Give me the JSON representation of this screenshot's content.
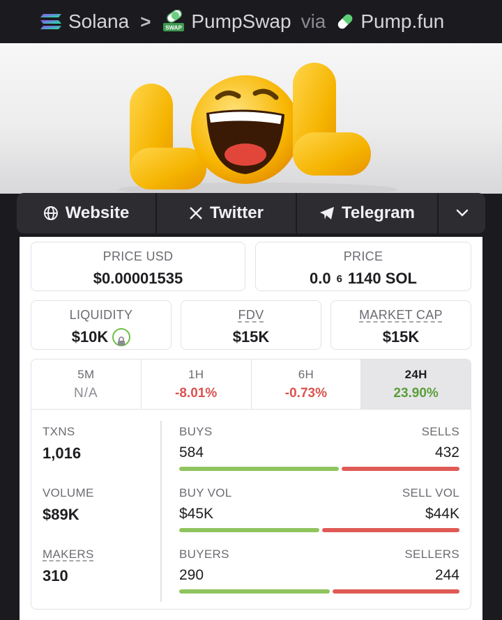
{
  "breadcrumb": {
    "chain": "Solana",
    "separator": ">",
    "dex": "PumpSwap",
    "dex_icon_text": "SWAP",
    "via": "via",
    "launchpad": "Pump.fun"
  },
  "banner": {
    "logo_text": "LOL",
    "icon": "laughing-emoji-image"
  },
  "social": {
    "website": "Website",
    "twitter": "Twitter",
    "telegram": "Telegram",
    "more_icon": "chevron-down-icon"
  },
  "price": {
    "usd_label": "PRICE USD",
    "usd_value": "$0.00001535",
    "native_label": "PRICE",
    "native_prefix": "0.0",
    "native_zeros": "6",
    "native_suffix": "1140 SOL"
  },
  "metrics": {
    "liquidity_label": "LIQUIDITY",
    "liquidity_value": "$10K",
    "fdv_label": "FDV",
    "fdv_value": "$15K",
    "mcap_label": "MARKET CAP",
    "mcap_value": "$15K"
  },
  "timeframes": [
    {
      "label": "5M",
      "value": "N/A"
    },
    {
      "label": "1H",
      "value": "-8.01%"
    },
    {
      "label": "6H",
      "value": "-0.73%"
    },
    {
      "label": "24H",
      "value": "23.90%"
    }
  ],
  "stats": {
    "txns_label": "TXNS",
    "txns_value": "1,016",
    "buys_label": "BUYS",
    "buys_value": "584",
    "sells_label": "SELLS",
    "sells_value": "432",
    "buy_share": 0.575,
    "volume_label": "VOLUME",
    "volume_value": "$89K",
    "buyvol_label": "BUY VOL",
    "buyvol_value": "$45K",
    "sellvol_label": "SELL VOL",
    "sellvol_value": "$44K",
    "buyvol_share": 0.506,
    "makers_label": "MAKERS",
    "makers_value": "310",
    "buyers_label": "BUYERS",
    "buyers_value": "290",
    "sellers_label": "SELLERS",
    "sellers_value": "244",
    "buyers_share": 0.543
  },
  "colors": {
    "positive": "#5a9e3a",
    "negative": "#d9534f",
    "bar_green": "#8fc45e",
    "bar_red": "#e05a55"
  }
}
